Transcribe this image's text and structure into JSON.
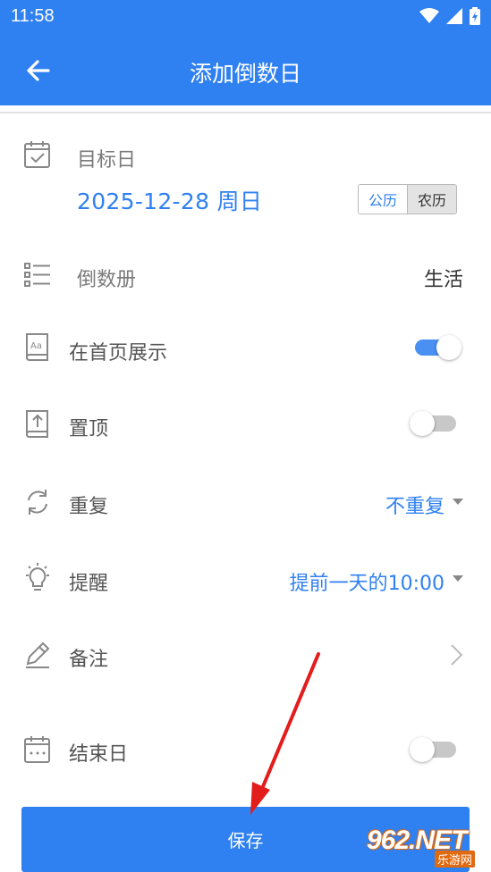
{
  "status_bar": {
    "time": "11:58"
  },
  "header": {
    "title": "添加倒数日"
  },
  "target_date": {
    "label": "目标日",
    "value": "2025-12-28 周日",
    "calendar_solar": "公历",
    "calendar_lunar": "农历",
    "selected_calendar": "公历"
  },
  "countdown_book": {
    "label": "倒数册",
    "value": "生活"
  },
  "show_on_home": {
    "label": "在首页展示",
    "enabled": true
  },
  "pin_top": {
    "label": "置顶",
    "enabled": false
  },
  "repeat": {
    "label": "重复",
    "value": "不重复"
  },
  "reminder": {
    "label": "提醒",
    "value": "提前一天的10:00"
  },
  "note": {
    "label": "备注"
  },
  "end_date": {
    "label": "结束日",
    "enabled": false
  },
  "save_button": {
    "label": "保存"
  },
  "watermark": {
    "brand": "962.NET",
    "sub": "乐游网"
  },
  "colors": {
    "primary": "#2f80f0",
    "toggle_on": "#4a8ff2",
    "toggle_off": "#c8c8c8",
    "annotation_arrow": "#e31c1c"
  }
}
